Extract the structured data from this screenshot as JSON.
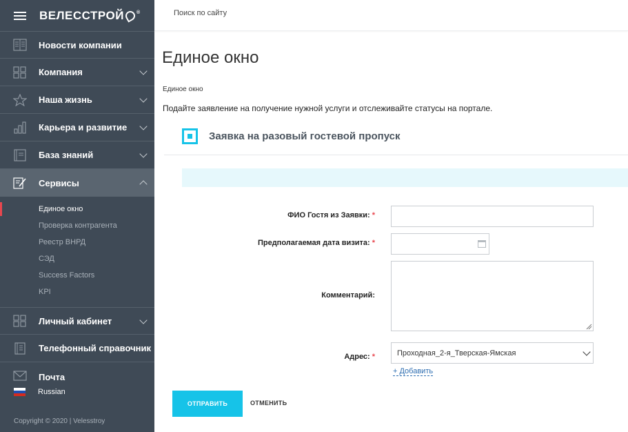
{
  "brand": {
    "logo_text": "ВЕЛЕССТРОЙ",
    "logo_reg": "®"
  },
  "sidebar": {
    "items": [
      {
        "label": "Новости компании",
        "icon": "newspaper-icon"
      },
      {
        "label": "Компания",
        "icon": "grid-icon"
      },
      {
        "label": "Наша жизнь",
        "icon": "star-icon"
      },
      {
        "label": "Карьера и развитие",
        "icon": "bar-chart-icon"
      },
      {
        "label": "База знаний",
        "icon": "book-icon"
      },
      {
        "label": "Сервисы",
        "icon": "edit-icon"
      },
      {
        "label": "Личный кабинет",
        "icon": "grid-icon"
      },
      {
        "label": "Телефонный справочник",
        "icon": "phonebook-icon"
      },
      {
        "label": "Почта",
        "icon": "mail-icon"
      }
    ],
    "services_sub": [
      "Единое окно",
      "Проверка контрагента",
      "Реестр ВНРД",
      "СЭД",
      "Success Factors",
      "KPI"
    ],
    "language": "Russian",
    "copyright": "Copyright © 2020 | Velesstroy"
  },
  "topbar": {
    "search_placeholder": "Поиск по сайту"
  },
  "main": {
    "title": "Единое окно",
    "breadcrumb": "Единое окно",
    "intro": "Подайте заявление на получение нужной услуги и отслеживайте статусы на портале.",
    "form_title": "Заявка на разовый гостевой пропуск",
    "fields": {
      "fio_label": "ФИО Гостя из Заявки:",
      "date_label": "Предполагаемая дата визита:",
      "comment_label": "Комментарий:",
      "address_label": "Адрес:",
      "address_value": "Проходная_2-я_Тверская-Ямская",
      "required_mark": "*"
    },
    "add_link": "+ Добавить",
    "submit_label": "ОТПРАВИТЬ",
    "cancel_label": "ОТМЕНИТЬ"
  },
  "colors": {
    "sidebar_bg": "#3f4a56",
    "accent": "#16c3e8",
    "active_marker": "#e8474f",
    "info_bar": "#e6f8fc"
  }
}
